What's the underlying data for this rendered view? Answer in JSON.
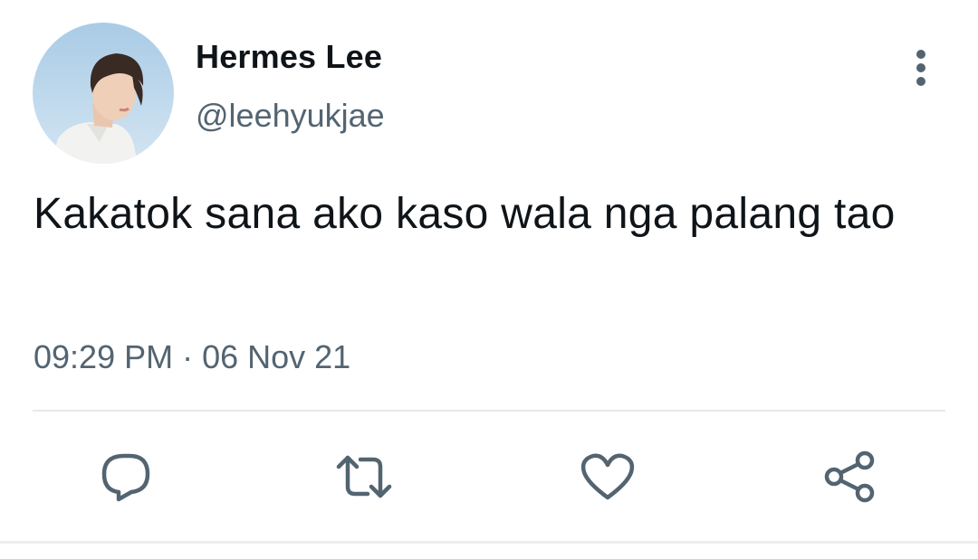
{
  "user": {
    "display_name": "Hermes Lee",
    "handle": "@leehyukjae"
  },
  "tweet": {
    "text": "Kakatok sana ako kaso wala nga palang tao",
    "timestamp": "09:29 PM · 06 Nov 21"
  },
  "icons": {
    "more": "more-vertical-icon",
    "reply": "reply-icon",
    "retweet": "retweet-icon",
    "like": "heart-icon",
    "share": "share-icon"
  },
  "colors": {
    "text_primary": "#0f1419",
    "text_secondary": "#536471",
    "icon": "#536471",
    "divider": "#e7e9ec"
  }
}
